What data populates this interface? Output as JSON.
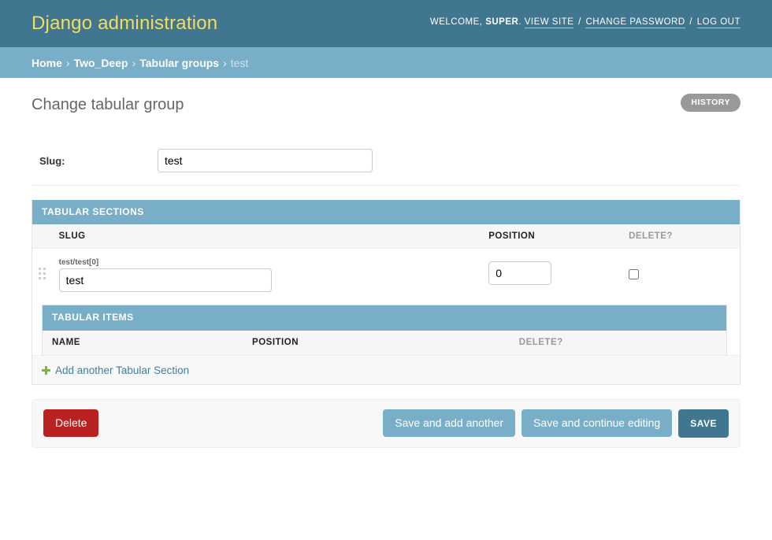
{
  "header": {
    "branding": "Django administration",
    "user_tools": {
      "welcome_prefix": "Welcome,",
      "username": "super",
      "period": ".",
      "view_site": "View site",
      "change_password": "Change password",
      "log_out": "Log out",
      "separator": "/"
    }
  },
  "breadcrumbs": {
    "items": [
      {
        "label": "Home",
        "current": false
      },
      {
        "label": "Two_Deep",
        "current": false
      },
      {
        "label": "Tabular groups",
        "current": false
      },
      {
        "label": "test",
        "current": true
      }
    ],
    "separator": "›"
  },
  "content": {
    "title": "Change tabular group",
    "object_tools": {
      "history": "History"
    }
  },
  "form": {
    "slug_field": {
      "label": "Slug:",
      "value": "test",
      "placeholder": ""
    }
  },
  "inline_sections": {
    "heading": "Tabular sections",
    "columns": {
      "slug": "Slug",
      "position": "Position",
      "delete": "Delete?"
    },
    "rows": [
      {
        "original_label": "test/test[0]",
        "slug_value": "test",
        "slug_placeholder": "",
        "position_value": "0",
        "position_placeholder": "",
        "delete_checked": false,
        "nested": {
          "heading": "Tabular items",
          "columns": {
            "name": "Name",
            "position": "Position",
            "delete": "Delete?"
          },
          "rows": []
        }
      }
    ],
    "add_link": "Add another Tabular Section"
  },
  "submit_row": {
    "delete": "Delete",
    "save_and_add_another": "Save and add another",
    "save_and_continue": "Save and continue editing",
    "save": "Save"
  },
  "colors": {
    "header_bg": "#417690",
    "branding": "#f5dd5d",
    "breadcrumb_bg": "#79aec8",
    "inline_heading_bg": "#79aec8",
    "delete_button": "#ba2121",
    "save_button": "#417690",
    "secondary_button": "#79aec8",
    "link": "#447e9b",
    "add_icon": "#70bf2b",
    "history_button": "#999999"
  }
}
